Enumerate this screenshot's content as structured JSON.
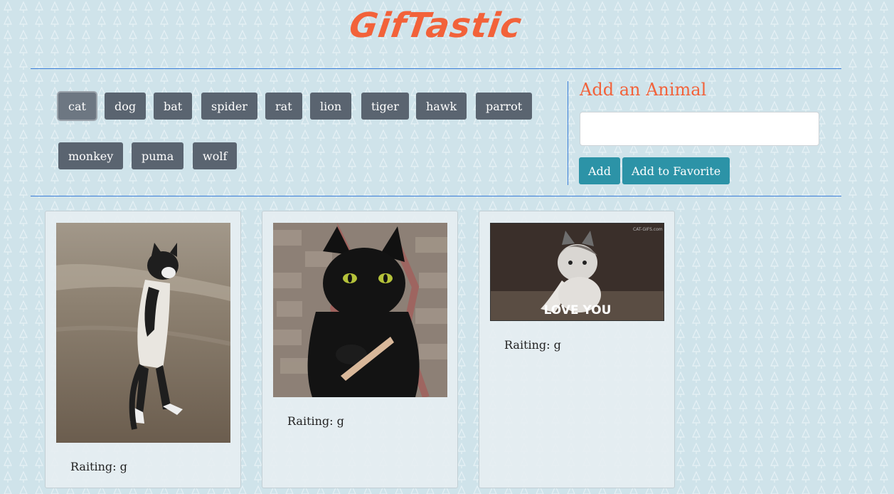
{
  "app": {
    "title": "GifTastic"
  },
  "animals": [
    {
      "label": "cat",
      "active": true
    },
    {
      "label": "dog"
    },
    {
      "label": "bat"
    },
    {
      "label": "spider"
    },
    {
      "label": "rat"
    },
    {
      "label": "lion"
    },
    {
      "label": "tiger"
    },
    {
      "label": "hawk"
    },
    {
      "label": "parrot"
    },
    {
      "label": "monkey"
    },
    {
      "label": "puma"
    },
    {
      "label": "wolf"
    }
  ],
  "add_panel": {
    "title": "Add an Animal",
    "input_value": "",
    "add_label": "Add",
    "favorite_label": "Add to Favorite"
  },
  "gifs": [
    {
      "rating": "Raiting: g"
    },
    {
      "rating": "Raiting: g"
    },
    {
      "rating": "Raiting: g",
      "caption": "LOVE YOU",
      "watermark": "CAT-GIFS.com"
    }
  ],
  "colors": {
    "accent": "#f2623a",
    "button": "#5a6470",
    "action": "#2c93a7"
  }
}
